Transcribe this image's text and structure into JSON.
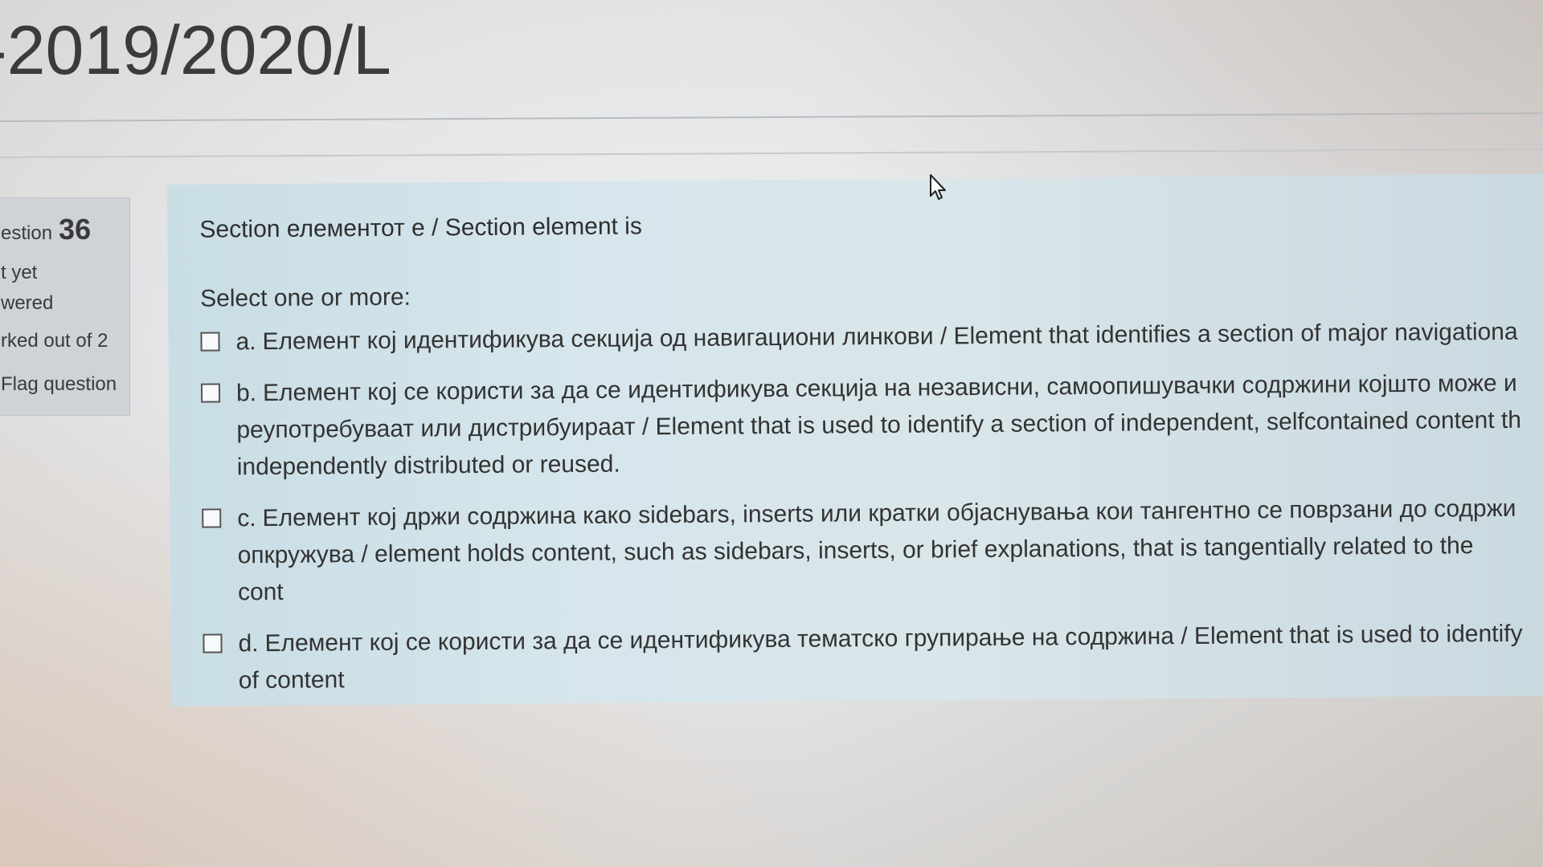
{
  "course": {
    "title": "-2019/2020/L"
  },
  "question_info": {
    "label": "estion",
    "number": "36",
    "state_line1": "t yet",
    "state_line2": "wered",
    "marks": "rked out of 2",
    "flag_label": "Flag question"
  },
  "question": {
    "text": "Section елементот е / Section element is",
    "prompt": "Select one or more:",
    "options": [
      {
        "letter": "a.",
        "text": "Елемент кој идентификува секција од навигациони линкови / Element that identifies a section of major navigationa",
        "checked": false
      },
      {
        "letter": "b.",
        "text": "Елемент кој се користи за да се идентификува секција на независни, самоопишувачки содржини којшто може и реупотребуваат или дистрибуираат / Element that is used to identify a section of independent, selfcontained content th independently distributed or reused.",
        "checked": false
      },
      {
        "letter": "c.",
        "text": "Елемент кој држи содржина како sidebars, inserts или кратки објаснувања кои тангентно се поврзани до содржи опкружува / element holds content, such as sidebars, inserts, or brief explanations, that is tangentially related to the cont",
        "checked": false
      },
      {
        "letter": "d.",
        "text": "Елемент кој се користи за да се идентификува тематско групирање на содржина / Element that is used to identify of content",
        "checked": false
      }
    ]
  },
  "icons": {
    "cursor": "mouse-pointer-icon"
  }
}
